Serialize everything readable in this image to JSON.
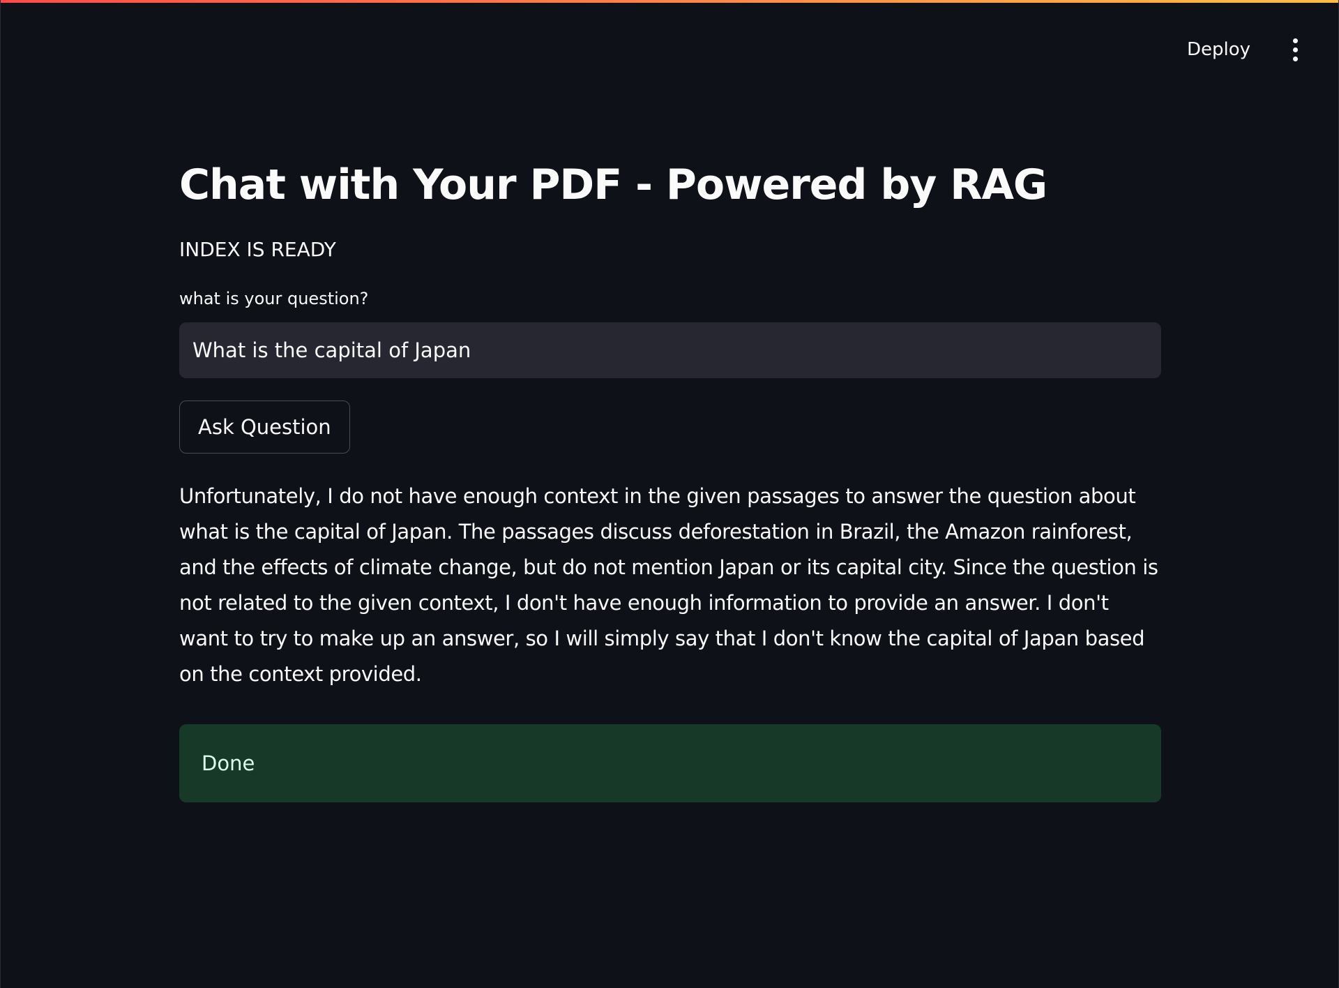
{
  "header": {
    "deploy_label": "Deploy",
    "menu_icon": "vertical-ellipsis-icon"
  },
  "main": {
    "title": "Chat with Your PDF - Powered by RAG",
    "status": "INDEX IS READY",
    "question_label": "what is your question?",
    "question_value": "What is the capital of Japan",
    "ask_button_label": "Ask Question",
    "answer": "Unfortunately, I do not have enough context in the given passages to answer the question about what is the capital of Japan. The passages discuss deforestation in Brazil, the Amazon rainforest, and the effects of climate change, but do not mention Japan or its capital city. Since the question is not related to the given context, I don't have enough information to provide an answer. I don't want to try to make up an answer, so I will simply say that I don't know the capital of Japan based on the context provided.",
    "success_message": "Done"
  },
  "colors": {
    "background": "#0e1117",
    "input_background": "#262730",
    "success_background": "#173928",
    "success_text": "#dffde9",
    "accent_gradient_start": "#ff4b4b",
    "accent_gradient_end": "#ffbd45"
  }
}
